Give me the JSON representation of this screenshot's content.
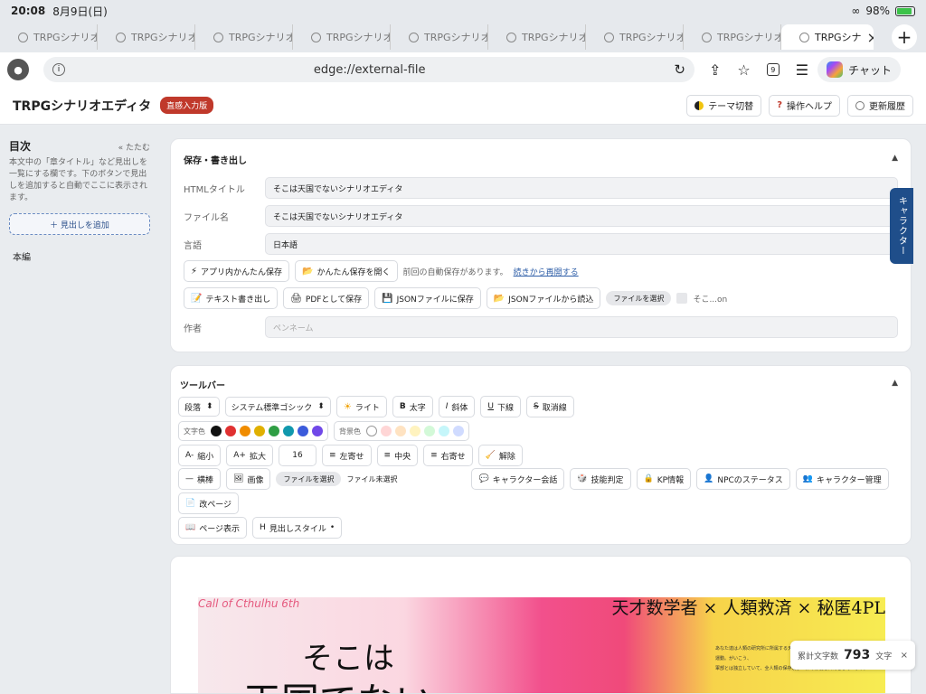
{
  "status": {
    "time": "20:08",
    "date": "8月9日(日)",
    "battery": "98%"
  },
  "tabs": [
    {
      "label": "TRPGシナリオ"
    },
    {
      "label": "TRPGシナリオ"
    },
    {
      "label": "TRPGシナリオ"
    },
    {
      "label": "TRPGシナリオ"
    },
    {
      "label": "TRPGシナリオ"
    },
    {
      "label": "TRPGシナリオ"
    },
    {
      "label": "TRPGシナリオ"
    },
    {
      "label": "TRPGシナリオ"
    },
    {
      "label": "TRPGシナ"
    }
  ],
  "addressbar": {
    "url": "edge://external-file",
    "tab_count": "9",
    "chat_label": "チャット"
  },
  "header": {
    "title": "TRPGシナリオエディタ",
    "badge": "直感入力版",
    "theme_label": "テーマ切替",
    "help_label": "操作ヘルプ",
    "history_label": "更新履歴"
  },
  "sidebar": {
    "title": "目次",
    "collapse_label": "« たたむ",
    "description": "本文中の「章タイトル」など見出しを一覧にする欄です。下のボタンで見出しを追加すると自動でここに表示されます。",
    "add_label": "＋ 見出しを追加",
    "items": [
      "本編"
    ]
  },
  "save_panel": {
    "title": "保存・書き出し",
    "html_title_label": "HTMLタイトル",
    "html_title_value": "そこは天国でないシナリオエディタ",
    "filename_label": "ファイル名",
    "filename_value": "そこは天国でないシナリオエディタ",
    "language_label": "言語",
    "language_value": "日本語",
    "quick_save": "アプリ内かんたん保存",
    "quick_open": "かんたん保存を開く",
    "autosave_note": "前回の自動保存があります。",
    "resume_link": "続きから再開する",
    "text_export": "テキスト書き出し",
    "pdf_save": "PDFとして保存",
    "json_save": "JSONファイルに保存",
    "json_load": "JSONファイルから読込",
    "file_select": "ファイルを選択",
    "file_name": "そこ...on",
    "author_label": "作者",
    "author_placeholder": "ペンネーム"
  },
  "toolbar_panel": {
    "title": "ツールバー",
    "paragraph": "段落",
    "font": "システム標準ゴシック",
    "light": "ライト",
    "bold": "太字",
    "italic": "斜体",
    "underline": "下線",
    "strike": "取消線",
    "text_color_label": "文字色",
    "text_colors": [
      "#111111",
      "#e03131",
      "#f08c00",
      "#e0b000",
      "#2f9e44",
      "#1098ad",
      "#3b5bdb",
      "#7048e8"
    ],
    "bg_color_label": "背景色",
    "bg_colors": [
      "#ffffff",
      "#ffd6d6",
      "#ffe3c2",
      "#fff3bf",
      "#d3f9d8",
      "#c5f6fa",
      "#d0dbff"
    ],
    "shrink": "縮小",
    "enlarge": "拡大",
    "font_size": "16",
    "align_left": "左寄せ",
    "align_center": "中央",
    "align_right": "右寄せ",
    "clear": "解除",
    "hr": "横棒",
    "image": "画像",
    "file_select": "ファイルを選択",
    "file_none": "ファイル未選択",
    "char_talk": "キャラクター会話",
    "skill": "技能判定",
    "kp_info": "KP情報",
    "npc_status": "NPCのステータス",
    "char_manage": "キャラクター管理",
    "page_break": "改ページ",
    "page_view": "ページ表示",
    "heading_style": "見出しスタイル"
  },
  "cover": {
    "subtitle": "Call of Cthulhu 6th",
    "tagline": "天才数学者 × 人類救済 × 秘匿4PL",
    "main1": "そこは",
    "main2": "天国でない",
    "small1": "あなた達は人類の研究所に所属する天才",
    "small2": "運動。がいこう、",
    "small3": "軍部とは独立していて、全人類の保存及び世界の修復を目的としています。"
  },
  "character_tab": "キャラクター",
  "counter": {
    "label": "累計文字数",
    "value": "793",
    "unit": "文字"
  }
}
